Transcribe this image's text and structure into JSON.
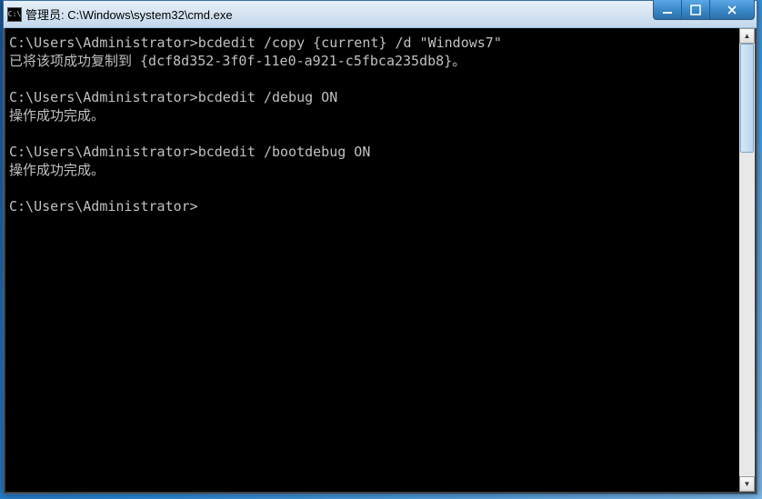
{
  "window": {
    "title": "管理员: C:\\Windows\\system32\\cmd.exe",
    "icon_text": "C:\\"
  },
  "terminal": {
    "lines": [
      {
        "prompt": "C:\\Users\\Administrator>",
        "command": "bcdedit /copy {current} /d \"Windows7\""
      },
      {
        "output": "已将该项成功复制到 {dcf8d352-3f0f-11e0-a921-c5fbca235db8}。"
      },
      {
        "blank": true
      },
      {
        "prompt": "C:\\Users\\Administrator>",
        "command": "bcdedit /debug ON"
      },
      {
        "output": "操作成功完成。"
      },
      {
        "blank": true
      },
      {
        "prompt": "C:\\Users\\Administrator>",
        "command": "bcdedit /bootdebug ON"
      },
      {
        "output": "操作成功完成。"
      },
      {
        "blank": true
      },
      {
        "prompt": "C:\\Users\\Administrator>",
        "command": ""
      }
    ]
  }
}
